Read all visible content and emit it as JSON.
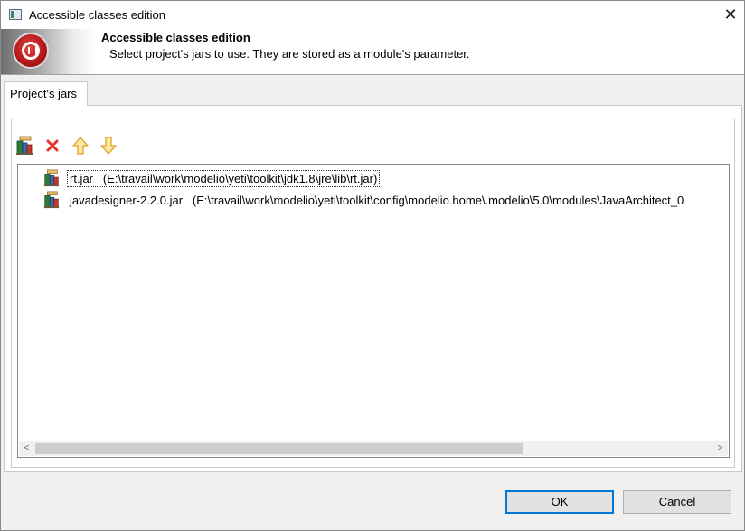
{
  "window": {
    "title": "Accessible classes edition",
    "close": "✕"
  },
  "banner": {
    "title": "Accessible classes edition",
    "subtitle": "Select project's jars to use. They are stored as a module's parameter."
  },
  "tabs": [
    {
      "label": "Project's jars",
      "selected": true
    }
  ],
  "toolbar": {
    "add_icon": "add-jar-icon",
    "remove_icon": "delete-icon",
    "up_icon": "move-up-icon",
    "down_icon": "move-down-icon",
    "remove_color": "#e8312c",
    "arrow_color": "#f0b020"
  },
  "jars": [
    {
      "name": "rt.jar",
      "path": "(E:\\travail\\work\\modelio\\yeti\\toolkit\\jdk1.8\\jre\\lib\\rt.jar)",
      "selected": true
    },
    {
      "name": "javadesigner-2.2.0.jar",
      "path": "(E:\\travail\\work\\modelio\\yeti\\toolkit\\config\\modelio.home\\.modelio\\5.0\\modules\\JavaArchitect_0",
      "selected": false
    }
  ],
  "scrollbar": {
    "left_arrow": "<",
    "right_arrow": ">"
  },
  "buttons": {
    "ok": "OK",
    "cancel": "Cancel"
  },
  "colors": {
    "focus_border": "#0078d7"
  }
}
